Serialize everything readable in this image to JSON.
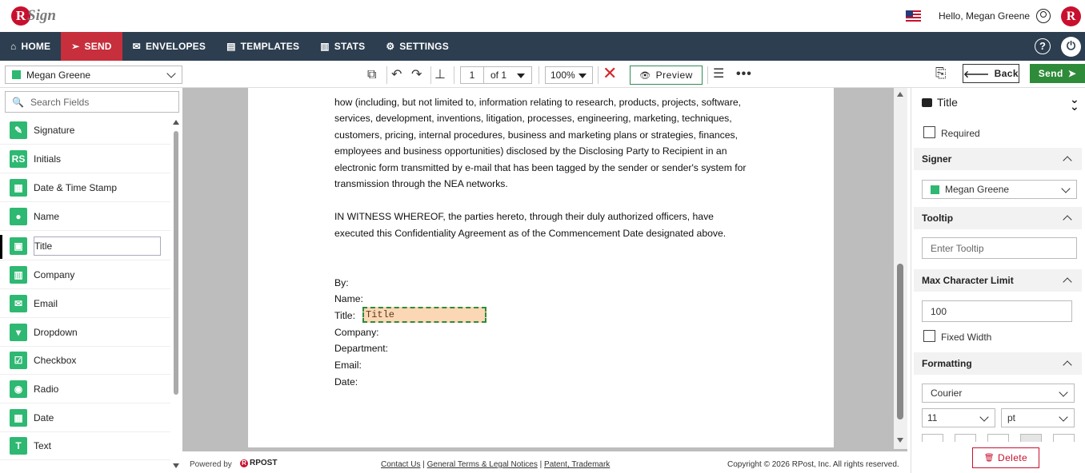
{
  "header": {
    "greeting": "Hello, Megan Greene",
    "logo_letter": "R",
    "logo_text": "Sign",
    "brand_letter": "R"
  },
  "nav": {
    "items": [
      {
        "label": "HOME",
        "icon": "home-icon"
      },
      {
        "label": "SEND",
        "icon": "send-icon",
        "active": true
      },
      {
        "label": "ENVELOPES",
        "icon": "envelope-icon"
      },
      {
        "label": "TEMPLATES",
        "icon": "document-icon"
      },
      {
        "label": "STATS",
        "icon": "bar-chart-icon"
      },
      {
        "label": "SETTINGS",
        "icon": "gear-icon"
      }
    ],
    "help": "?",
    "power": "⏻"
  },
  "toolbar": {
    "recipient": "Megan Greene",
    "page_current": "1",
    "page_of": "of  1",
    "zoom": "100%",
    "preview_label": "Preview",
    "back_label": "Back",
    "send_label": "Send"
  },
  "fields": {
    "search_placeholder": "Search Fields",
    "items": [
      {
        "label": "Signature",
        "icon": "pen-icon"
      },
      {
        "label": "Initials",
        "icon": "initials-icon"
      },
      {
        "label": "Date & Time Stamp",
        "icon": "calendar-clock-icon"
      },
      {
        "label": "Name",
        "icon": "person-icon"
      },
      {
        "label": "Title",
        "icon": "briefcase-icon",
        "selected": true
      },
      {
        "label": "Company",
        "icon": "building-icon"
      },
      {
        "label": "Email",
        "icon": "mail-icon"
      },
      {
        "label": "Dropdown",
        "icon": "dropdown-icon"
      },
      {
        "label": "Checkbox",
        "icon": "checkbox-icon"
      },
      {
        "label": "Radio",
        "icon": "radio-icon"
      },
      {
        "label": "Date",
        "icon": "calendar-icon"
      },
      {
        "label": "Text",
        "icon": "text-icon"
      }
    ]
  },
  "document": {
    "lines": [
      "how (including, but not limited to, information relating to research, products, projects, software,",
      "services, development, inventions, litigation, processes, engineering, marketing, techniques,",
      "customers, pricing, internal procedures, business and marketing plans or strategies, finances,",
      "employees and business opportunities) disclosed by the Disclosing Party to Recipient in an",
      "electronic form transmitted by e-mail that has been tagged by the sender or sender's system for",
      "transmission through the NEA networks."
    ],
    "witness_lines": [
      "IN WITNESS WHEREOF, the parties hereto, through their duly authorized officers, have",
      "executed this Confidentiality Agreement as of the Commencement Date designated above."
    ],
    "sig_labels": [
      "By:",
      "Name:",
      "Title:",
      "Company:",
      "Department:",
      "Email:",
      "Date:"
    ],
    "title_field_value": "Title"
  },
  "footer": {
    "powered_by": "Powered by",
    "rpost": "RPOST",
    "contact": "Contact Us",
    "terms": "General Terms & Legal Notices",
    "patent": "Patent, Trademark",
    "copyright": "Copyright © 2026 RPost, Inc. All rights reserved."
  },
  "properties": {
    "title": "Title",
    "required_label": "Required",
    "signer_header": "Signer",
    "signer_value": "Megan Greene",
    "tooltip_header": "Tooltip",
    "tooltip_placeholder": "Enter Tooltip",
    "max_char_header": "Max Character Limit",
    "max_char_value": "100",
    "fixed_width_label": "Fixed Width",
    "formatting_header": "Formatting",
    "font_value": "Courier",
    "size_value": "11",
    "unit_value": "pt",
    "delete_label": "Delete"
  },
  "colors": {
    "nav_bg": "#2d3e50",
    "active_nav": "#c62f3b",
    "brand_red": "#c8102e",
    "field_green": "#2eb872",
    "send_green": "#2e8b3a"
  }
}
